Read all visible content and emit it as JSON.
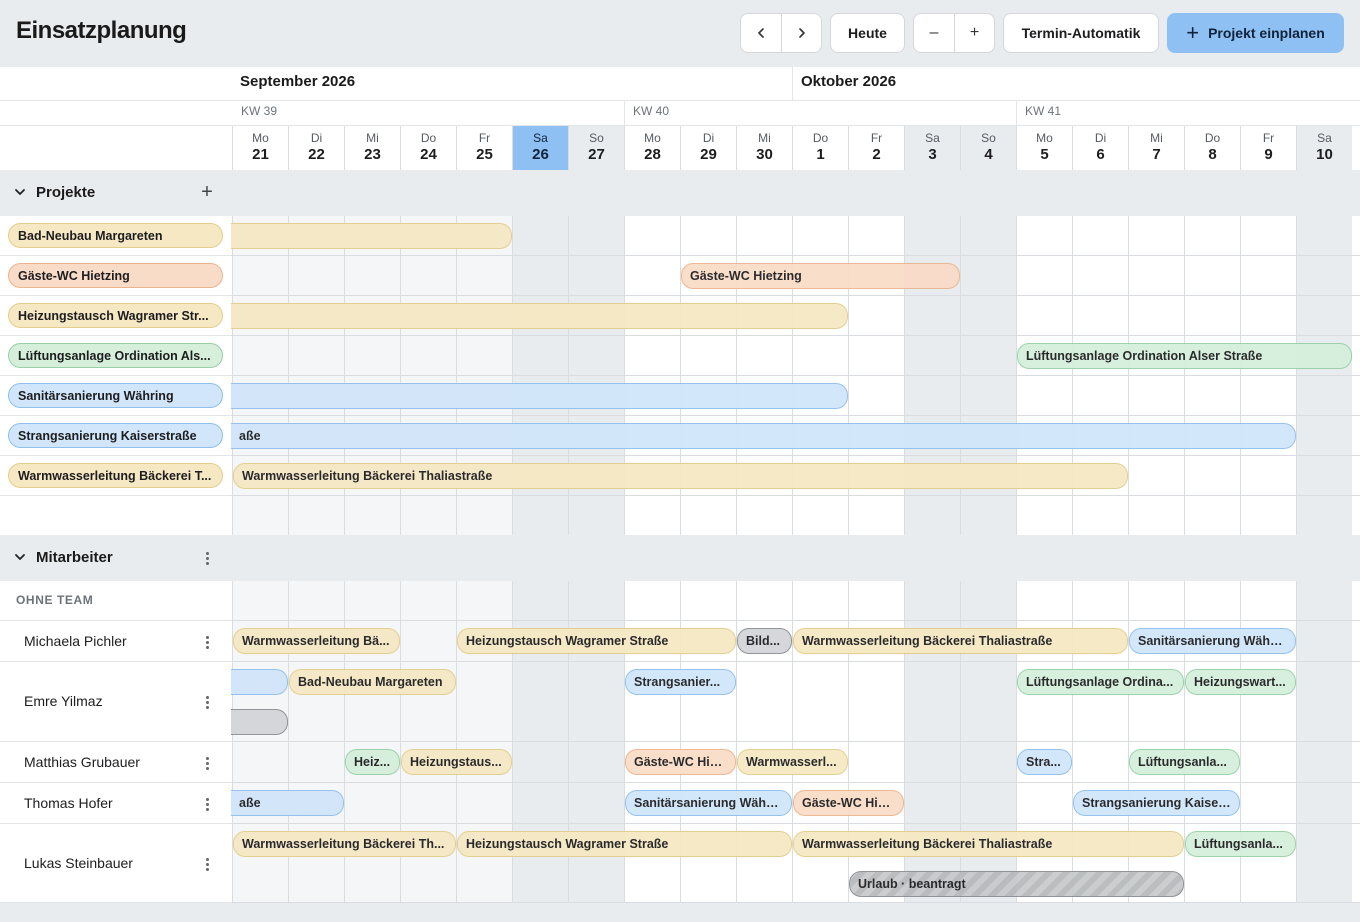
{
  "app": {
    "title": "Einsatzplanung"
  },
  "toolbar": {
    "prev_icon": "chevron-left-icon",
    "next_icon": "chevron-right-icon",
    "today_label": "Heute",
    "zoom_out_label": "–",
    "zoom_in_label": "+",
    "auto_label": "Termin-Automatik",
    "plan_label": "Projekt einplanen",
    "plan_icon": "plus-icon"
  },
  "calendar": {
    "months": [
      "September 2026",
      "Oktober 2026"
    ],
    "weeks": [
      "KW 39",
      "KW 40",
      "KW 41"
    ],
    "days": [
      {
        "dn": "Mo",
        "dd": "21"
      },
      {
        "dn": "Di",
        "dd": "22"
      },
      {
        "dn": "Mi",
        "dd": "23"
      },
      {
        "dn": "Do",
        "dd": "24"
      },
      {
        "dn": "Fr",
        "dd": "25"
      },
      {
        "dn": "Sa",
        "dd": "26"
      },
      {
        "dn": "So",
        "dd": "27"
      },
      {
        "dn": "Mo",
        "dd": "28"
      },
      {
        "dn": "Di",
        "dd": "29"
      },
      {
        "dn": "Mi",
        "dd": "30"
      },
      {
        "dn": "Do",
        "dd": "1"
      },
      {
        "dn": "Fr",
        "dd": "2"
      },
      {
        "dn": "Sa",
        "dd": "3"
      },
      {
        "dn": "So",
        "dd": "4"
      },
      {
        "dn": "Mo",
        "dd": "5"
      },
      {
        "dn": "Di",
        "dd": "6"
      },
      {
        "dn": "Mi",
        "dd": "7"
      },
      {
        "dn": "Do",
        "dd": "8"
      },
      {
        "dn": "Fr",
        "dd": "9"
      },
      {
        "dn": "Sa",
        "dd": "10"
      }
    ]
  },
  "projects": {
    "title": "Projekte",
    "add_icon": "plus-icon",
    "items": [
      {
        "label": "Bad-Neubau Margareten",
        "bar": "",
        "color": "#f6e8c3"
      },
      {
        "label": "Gäste-WC Hietzing",
        "bar": "Gäste-WC Hietzing",
        "color": "#f9dcc7"
      },
      {
        "label": "Heizungstausch Wagramer Str...",
        "bar": "",
        "color": "#f6e8c3"
      },
      {
        "label": "Lüftungsanlage Ordination Als...",
        "bar": "Lüftungsanlage Ordination Alser Straße",
        "color": "#d5efdb"
      },
      {
        "label": "Sanitärsanierung Währing",
        "bar": "",
        "color": "#d1e6fa"
      },
      {
        "label": "Strangsanierung Kaiserstraße",
        "bar": "aße",
        "color": "#d1e6fa"
      },
      {
        "label": "Warmwasserleitung Bäckerei T...",
        "bar": "Warmwasserleitung Bäckerei Thaliastraße",
        "color": "#f6e8c3"
      }
    ]
  },
  "staff": {
    "title": "Mitarbeiter",
    "team_label": "OHNE TEAM",
    "members": [
      {
        "name": "Michaela Pichler",
        "bars": [
          "Warmwasserleitung Bä...",
          "Heizungstausch Wagramer Straße",
          "Bild...",
          "Warmwasserleitung Bäckerei Thaliastraße",
          "Sanitärsanierung Währi..."
        ]
      },
      {
        "name": "Emre Yilmaz",
        "bars": [
          "",
          "Bad-Neubau Margareten",
          "Strangsanier...",
          "Lüftungsanlage Ordina...",
          "Heizungswart...",
          ""
        ]
      },
      {
        "name": "Matthias Grubauer",
        "bars": [
          "Heiz...",
          "Heizungstaus...",
          "Gäste-WC Hie...",
          "Warmwasserl...",
          "Stra...",
          "Lüftungsanla..."
        ]
      },
      {
        "name": "Thomas Hofer",
        "bars": [
          "aße",
          "Sanitärsanierung Währi...",
          "Gäste-WC Hie...",
          "Strangsanierung Kaiser..."
        ]
      },
      {
        "name": "Lukas Steinbauer",
        "bars": [
          "Warmwasserleitung Bäckerei Th...",
          "Heizungstausch Wagramer Straße",
          "Warmwasserleitung Bäckerei Thaliastraße",
          "Lüftungsanla...",
          "Urlaub · beantragt"
        ]
      }
    ]
  },
  "colors": {
    "accent": "#8ec0f3",
    "yellow": "#f6e8c3",
    "orange": "#f9dcc7",
    "green": "#d5efdb",
    "blue": "#d1e6fa",
    "gray": "#d3d5d8"
  }
}
